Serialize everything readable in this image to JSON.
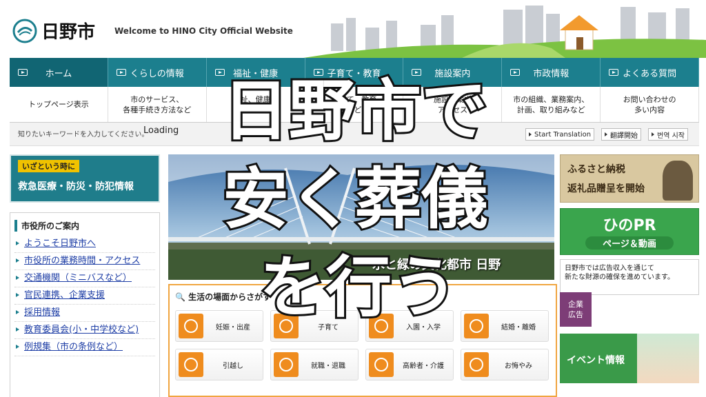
{
  "header": {
    "logo_name": "日野市",
    "tagline": "Welcome to HINO City Official Website"
  },
  "nav": [
    {
      "label": "ホーム",
      "sub": "トップページ表示"
    },
    {
      "label": "くらしの情報",
      "sub": "市のサービス、\n各種手続き方法など"
    },
    {
      "label": "福祉・健康",
      "sub": "福祉、健康に\n届出など"
    },
    {
      "label": "子育て・教育",
      "sub": "子育て、教育\nなど"
    },
    {
      "label": "施設案内",
      "sub": "施設の案内\nアクセス"
    },
    {
      "label": "市政情報",
      "sub": "市の組織、業務案内、\n計画、取り組みなど"
    },
    {
      "label": "よくある質問",
      "sub": "お問い合わせの\n多い内容"
    }
  ],
  "search": {
    "hint": "知りたいキーワードを入力してください。",
    "status": "Loading",
    "translate_en": "Start Translation",
    "translate_zh": "翻譯開始",
    "translate_ko": "번역 시작"
  },
  "emergency": {
    "small": "いざという時に",
    "main": "救急医療・防災・防犯情報"
  },
  "guide": {
    "title": "市役所のご案内",
    "links": [
      "ようこそ日野市へ",
      "市役所の業務時間・アクセス",
      "交通機関（ミニバスなど）",
      "官民連携、企業支援",
      "採用情報",
      "教育委員会(小・中学校など)",
      "例規集（市の条例など）"
    ]
  },
  "hero": {
    "caption": "水と緑の文化都市 日野"
  },
  "life": {
    "title": "生活の場面からさがす",
    "items": [
      "妊娠・出産",
      "子育て",
      "入園・入学",
      "結婚・離婚",
      "引越し",
      "就職・退職",
      "高齢者・介護",
      "お悔やみ"
    ]
  },
  "right": {
    "furusato_1": "ふるさと納税",
    "furusato_2": "返礼品贈呈を開始",
    "pr_1": "ひのPR",
    "pr_2": "ページ＆動画",
    "ad_text": "日野市では広告収入を通じて\n新たな財源の確保を進めています。",
    "ad_box": "企業\n広告",
    "event": "イベント情報"
  },
  "overlay": {
    "line1": "日野市で",
    "line2": "安く葬儀",
    "line3": "を行う"
  },
  "colors": {
    "teal": "#1c7f8e",
    "orange": "#ef8c1e",
    "green": "#3aa54d"
  }
}
